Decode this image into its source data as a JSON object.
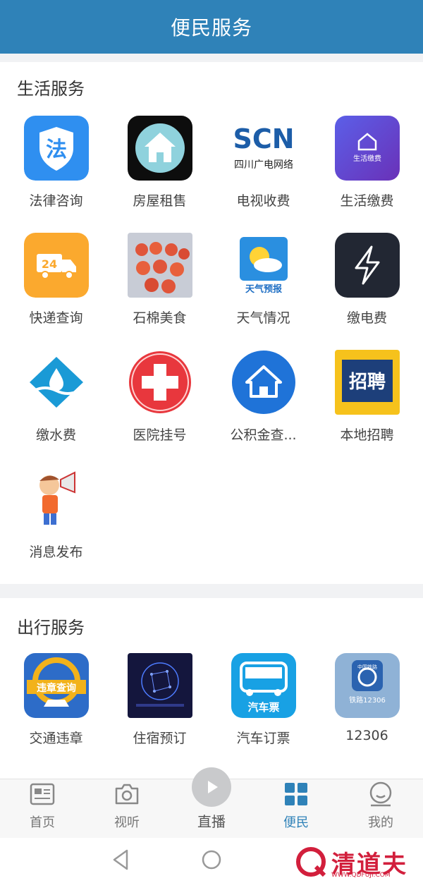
{
  "header": {
    "title": "便民服务"
  },
  "sections": [
    {
      "title": "生活服务",
      "items": [
        {
          "label": "法律咨询",
          "icon": "law-shield-icon"
        },
        {
          "label": "房屋租售",
          "icon": "house-icon"
        },
        {
          "label": "电视收费",
          "icon": "sctv-logo-icon",
          "icon_text": "SCN",
          "icon_sub": "四川广电网络"
        },
        {
          "label": "生活缴费",
          "icon": "utility-payment-icon",
          "icon_text": "生活缴费"
        },
        {
          "label": "快递查询",
          "icon": "delivery-truck-icon",
          "icon_text": "24"
        },
        {
          "label": "石棉美食",
          "icon": "food-photo-icon"
        },
        {
          "label": "天气情况",
          "icon": "weather-forecast-icon",
          "icon_text": "天气预报"
        },
        {
          "label": "缴电费",
          "icon": "lightning-icon"
        },
        {
          "label": "缴水费",
          "icon": "water-drop-icon"
        },
        {
          "label": "医院挂号",
          "icon": "red-cross-icon"
        },
        {
          "label": "公积金查...",
          "icon": "home-fund-icon"
        },
        {
          "label": "本地招聘",
          "icon": "recruitment-icon",
          "icon_text": "招聘"
        },
        {
          "label": "消息发布",
          "icon": "megaphone-boy-icon"
        }
      ]
    },
    {
      "title": "出行服务",
      "items": [
        {
          "label": "交通违章",
          "icon": "traffic-violation-icon",
          "icon_text": "违章查询"
        },
        {
          "label": "住宿预订",
          "icon": "hotel-booking-icon"
        },
        {
          "label": "汽车订票",
          "icon": "bus-ticket-icon",
          "icon_text": "汽车票"
        },
        {
          "label": "12306",
          "icon": "railway-12306-icon",
          "icon_text": "铁路12306",
          "icon_sub": "中国铁路"
        }
      ]
    }
  ],
  "tabbar": [
    {
      "label": "首页",
      "icon": "news-icon",
      "active": false
    },
    {
      "label": "视听",
      "icon": "camera-icon",
      "active": false
    },
    {
      "label": "直播",
      "icon": "play-icon",
      "active": false
    },
    {
      "label": "便民",
      "icon": "grid-icon",
      "active": true
    },
    {
      "label": "我的",
      "icon": "user-icon",
      "active": false
    }
  ],
  "watermark": {
    "text": "清道夫",
    "sub": "WWW.QDFUJI.COM"
  },
  "colors": {
    "brand": "#2f82b8",
    "active_tab": "#2f82b8"
  }
}
